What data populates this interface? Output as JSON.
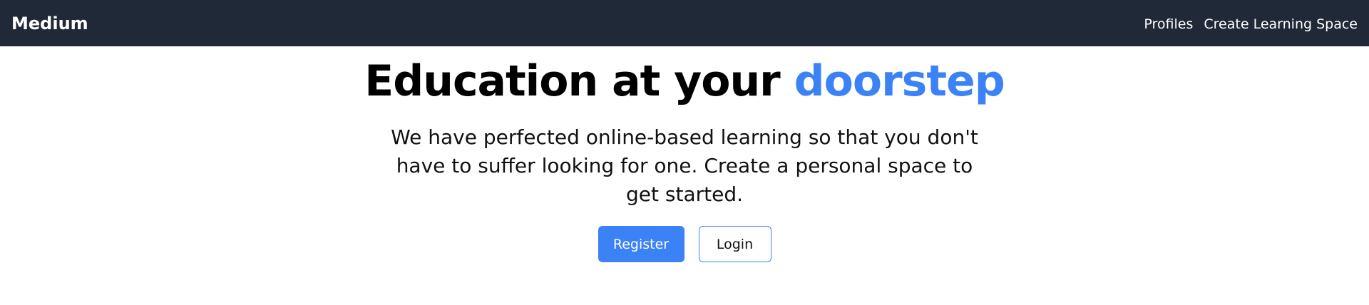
{
  "navbar": {
    "brand": "Medium",
    "links": [
      {
        "label": "Profiles"
      },
      {
        "label": "Create Learning Space"
      }
    ]
  },
  "hero": {
    "title_main": "Education at your ",
    "title_accent": "doorstep",
    "description": "We have perfected online-based learning so that you don't have to suffer looking for one. Create a personal space to get started.",
    "register_label": "Register",
    "login_label": "Login"
  },
  "colors": {
    "navbar_bg": "#1f2937",
    "accent": "#3b82f6",
    "text": "#111111",
    "background": "#ffffff"
  }
}
